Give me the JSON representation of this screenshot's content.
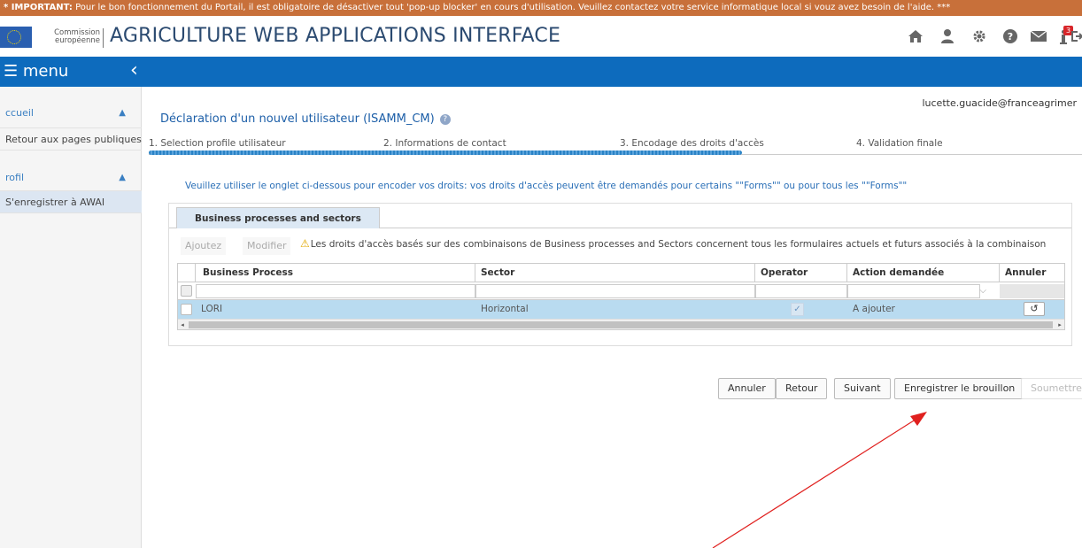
{
  "banner": {
    "label": "* IMPORTANT:",
    "text": "Pour le bon fonctionnement du Portail, il est obligatoire de désactiver tout 'pop-up blocker' en cours d'utilisation. Veuillez contactez votre service informatique local si vouz avez besoin de l'aide. ***"
  },
  "header": {
    "commission_line1": "Commission",
    "commission_line2": "européenne",
    "title": "AGRICULTURE WEB APPLICATIONS INTERFACE",
    "icons": [
      "home-icon",
      "user-icon",
      "gear-icon",
      "help-icon",
      "mail-icon",
      "info-icon",
      "logout-icon"
    ],
    "notification_count": "3"
  },
  "menubar": {
    "label": "menu",
    "collapse": "‹"
  },
  "sidebar": {
    "sections": [
      {
        "title": "ccueil",
        "items": [
          "Retour aux pages publiques"
        ]
      },
      {
        "title": "rofil",
        "items": [
          "S'enregistrer à AWAI"
        ]
      }
    ]
  },
  "user": {
    "email": "lucette.guacide@franceagrimer"
  },
  "page": {
    "title": "Déclaration d'un nouvel utilisateur (ISAMM_CM)",
    "help": "?"
  },
  "steps": [
    "1. Selection profile utilisateur",
    "2. Informations de contact",
    "3. Encodage des droits d'accès",
    "4. Validation finale"
  ],
  "info_text": "Veuillez utiliser le onglet ci-dessous pour encoder vos droits: vos droits d'accès peuvent être demandés pour certains \"\"Forms\"\" ou pour tous les \"\"Forms\"\"",
  "panel": {
    "tab": "Business processes and sectors",
    "toolbar": {
      "add": "Ajoutez",
      "modify": "Modifier",
      "warning": "Les droits d'accès basés sur des combinaisons de Business processes and Sectors concernent tous les formulaires actuels et futurs associés à la combinaison"
    },
    "grid": {
      "columns": [
        "Business Process",
        "Sector",
        "Operator",
        "Action demandée",
        "Annuler"
      ],
      "rows": [
        {
          "business_process": "LORI",
          "sector": "Horizontal",
          "operator_checked": true,
          "action": "A ajouter",
          "undo": "↺"
        }
      ]
    }
  },
  "actions": {
    "cancel": "Annuler",
    "back": "Retour",
    "next": "Suivant",
    "save_draft": "Enregistrer le brouillon",
    "submit": "Soumettre"
  }
}
